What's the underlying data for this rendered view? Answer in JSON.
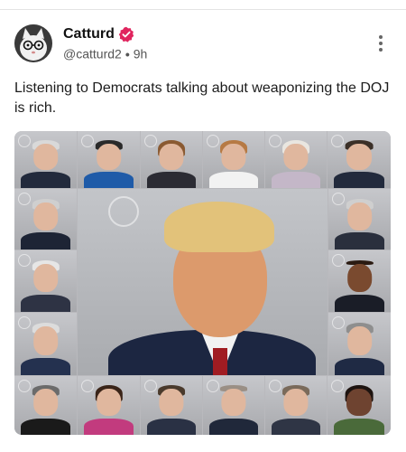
{
  "post": {
    "display_name": "Catturd",
    "handle": "@catturd2",
    "separator": "•",
    "time_ago": "9h",
    "text": "Listening to Democrats talking about weaponizing the DOJ is rich."
  },
  "icons": {
    "avatar": "cat-avatar-icon",
    "verified": "verified-badge-icon",
    "more": "more-vertical-icon"
  },
  "colors": {
    "verified_badge": "#e0245e",
    "suit_dark": "#1c2641",
    "tie_red": "#a01c22",
    "mugshot_background": "#b9b9bd"
  },
  "media": {
    "type": "image-collage",
    "grid_columns": 6,
    "grid_rows": 5,
    "description_visible": false
  }
}
